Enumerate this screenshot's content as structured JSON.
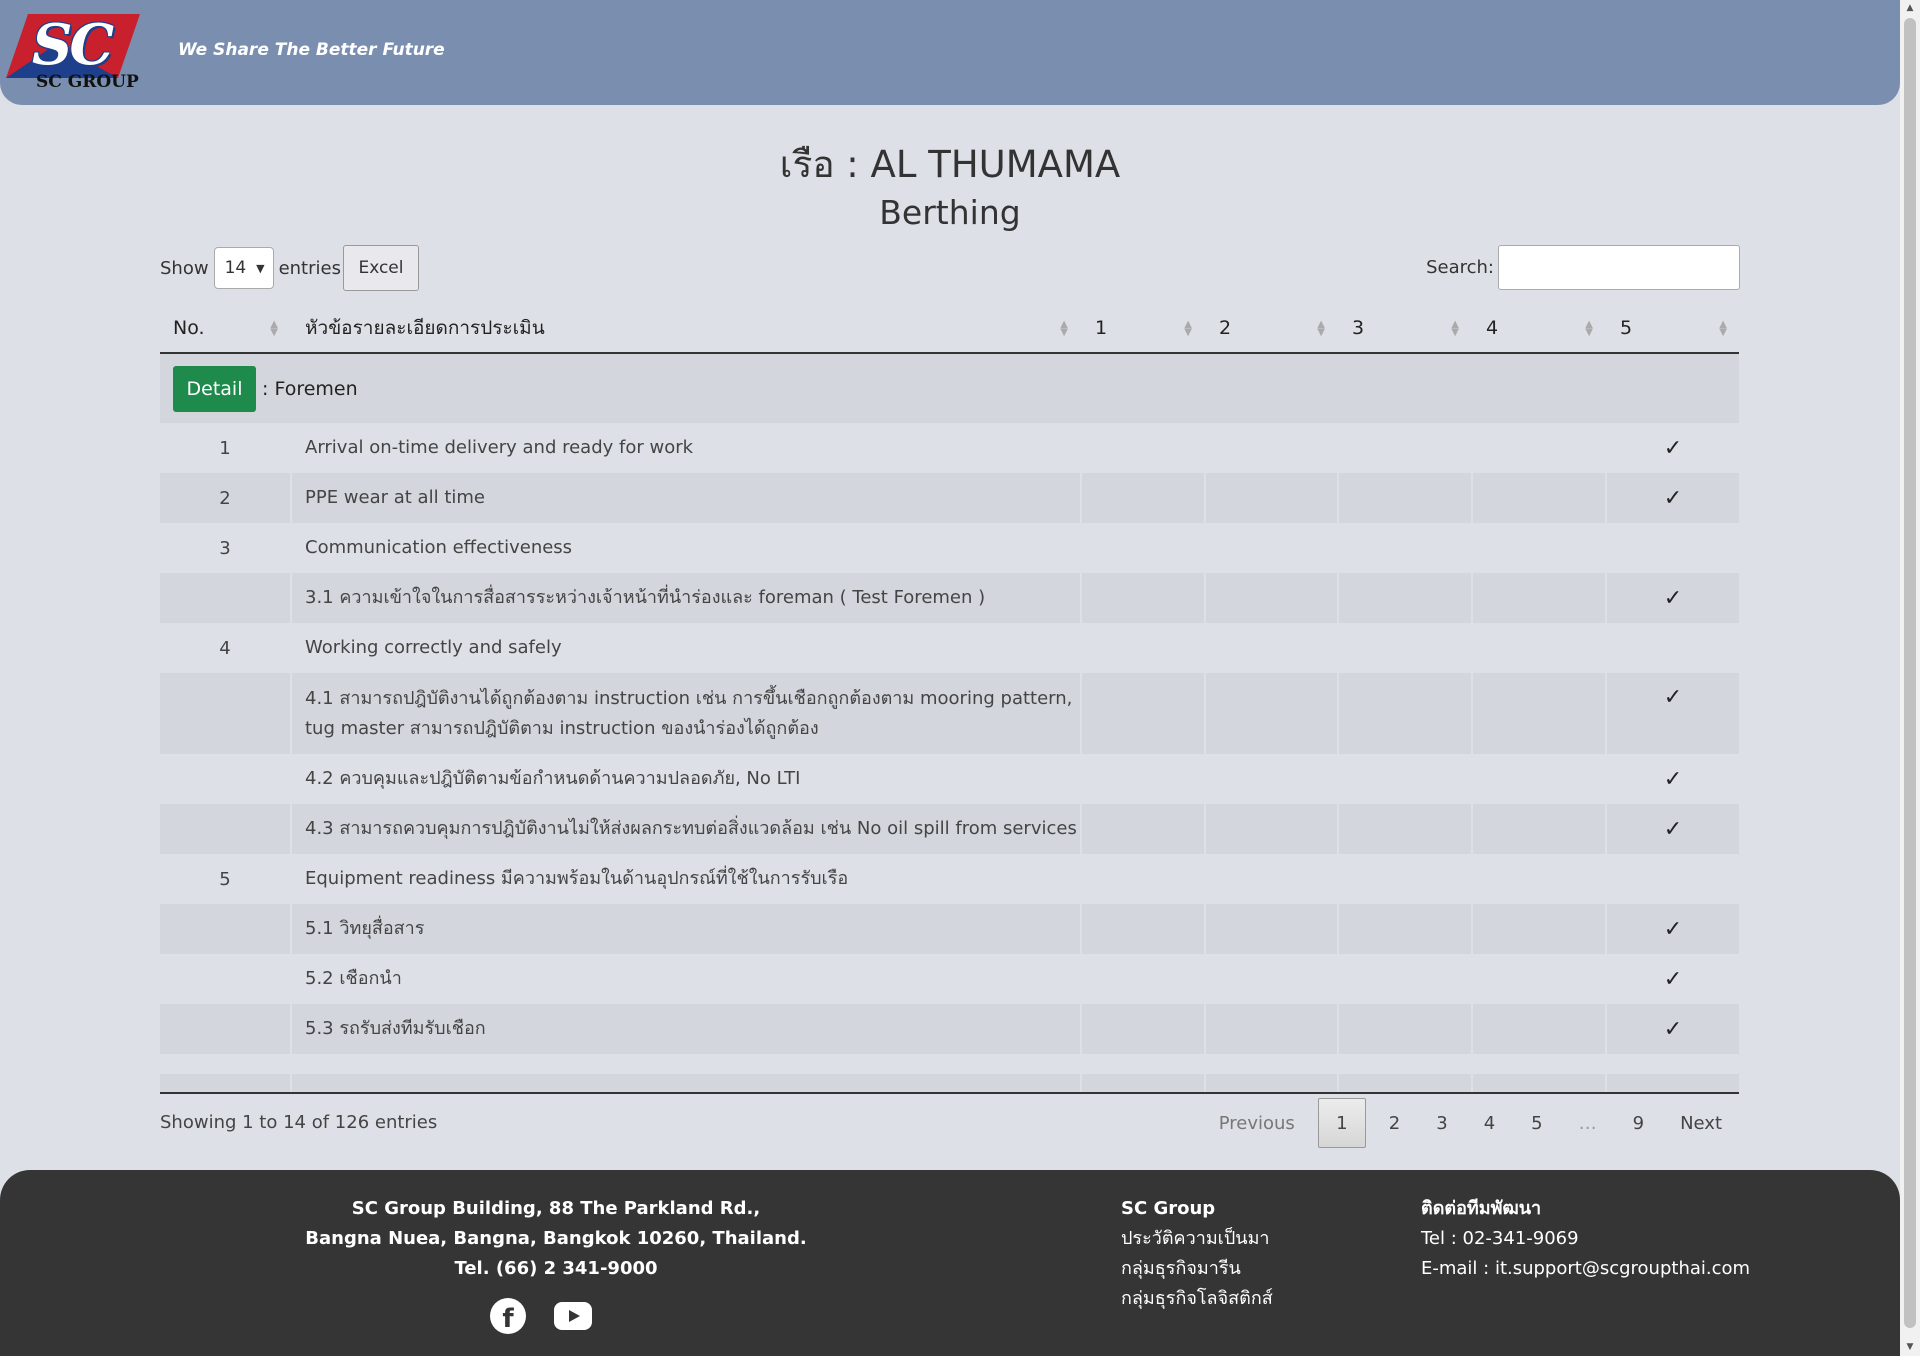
{
  "header": {
    "logo_text": "SC",
    "logo_sub": "SC GROUP",
    "tagline": "We Share The Better Future",
    "bg_color": "#7a8faf"
  },
  "page": {
    "title": "เรือ : AL THUMAMA",
    "subtitle": "Berthing"
  },
  "controls": {
    "show_label": "Show",
    "entries_value": "14",
    "entries_label": "entries",
    "excel_label": "Excel",
    "search_label": "Search:"
  },
  "table": {
    "headers": [
      "No.",
      "หัวข้อรายละเอียดการประเมิน",
      "1",
      "2",
      "3",
      "4",
      "5"
    ],
    "group": {
      "button": "Detail",
      "label": ": Foremen"
    },
    "rows": [
      {
        "no": "1",
        "desc": "Arrival on-time delivery and ready for work",
        "mark": "✓"
      },
      {
        "no": "2",
        "desc": "PPE wear at all time",
        "mark": "✓"
      },
      {
        "no": "3",
        "desc": "Communication effectiveness",
        "mark": ""
      },
      {
        "no": "",
        "desc": "3.1 ความเข้าใจในการสื่อสารระหว่างเจ้าหน้าที่นำร่องและ foreman ( Test Foremen )",
        "mark": "✓"
      },
      {
        "no": "4",
        "desc": "Working correctly and safely",
        "mark": ""
      },
      {
        "no": "",
        "desc": "4.1 สามารถปฎิบัติงานได้ถูกต้องตาม instruction เช่น การขึ้นเชือกถูกต้องตาม mooring pattern, tug master สามารถปฎิบัติตาม instruction ของนำร่องได้ถูกต้อง",
        "mark": "✓"
      },
      {
        "no": "",
        "desc": "4.2 ควบคุมและปฎิบัติตามข้อกำหนดด้านความปลอดภัย, No LTI",
        "mark": "✓"
      },
      {
        "no": "",
        "desc": "4.3 สามารถควบคุมการปฎิบัติงานไม่ให้ส่งผลกระทบต่อสิ่งแวดล้อม เช่น No oil spill from services",
        "mark": "✓"
      },
      {
        "no": "5",
        "desc": "Equipment readiness มีความพร้อมในด้านอุปกรณ์ที่ใช้ในการรับเรือ",
        "mark": ""
      },
      {
        "no": "",
        "desc": "5.1 วิทยุสื่อสาร",
        "mark": "✓"
      },
      {
        "no": "",
        "desc": "5.2 เชือกนำ",
        "mark": "✓"
      },
      {
        "no": "",
        "desc": "5.3 รถรับส่งทีมรับเชือก",
        "mark": "✓"
      }
    ]
  },
  "pagination": {
    "info": "Showing 1 to 14 of 126 entries",
    "previous": "Previous",
    "pages": [
      "1",
      "2",
      "3",
      "4",
      "5",
      "…",
      "9"
    ],
    "next": "Next",
    "current": "1"
  },
  "footer": {
    "address": [
      "SC Group Building, 88 The Parkland Rd.,",
      "Bangna Nuea, Bangna, Bangkok 10260, Thailand.",
      "Tel. (66) 2 341-9000"
    ],
    "links_title": "SC Group",
    "links": [
      "ประวัติความเป็นมา",
      "กลุ่มธุรกิจมารีน",
      "กลุ่มธุรกิจโลจิสติกส์"
    ],
    "contact_title": "ติดต่อทีมพัฒนา",
    "contact_tel": "Tel : 02-341-9069",
    "contact_email": "E-mail : it.support@scgroupthai.com"
  }
}
